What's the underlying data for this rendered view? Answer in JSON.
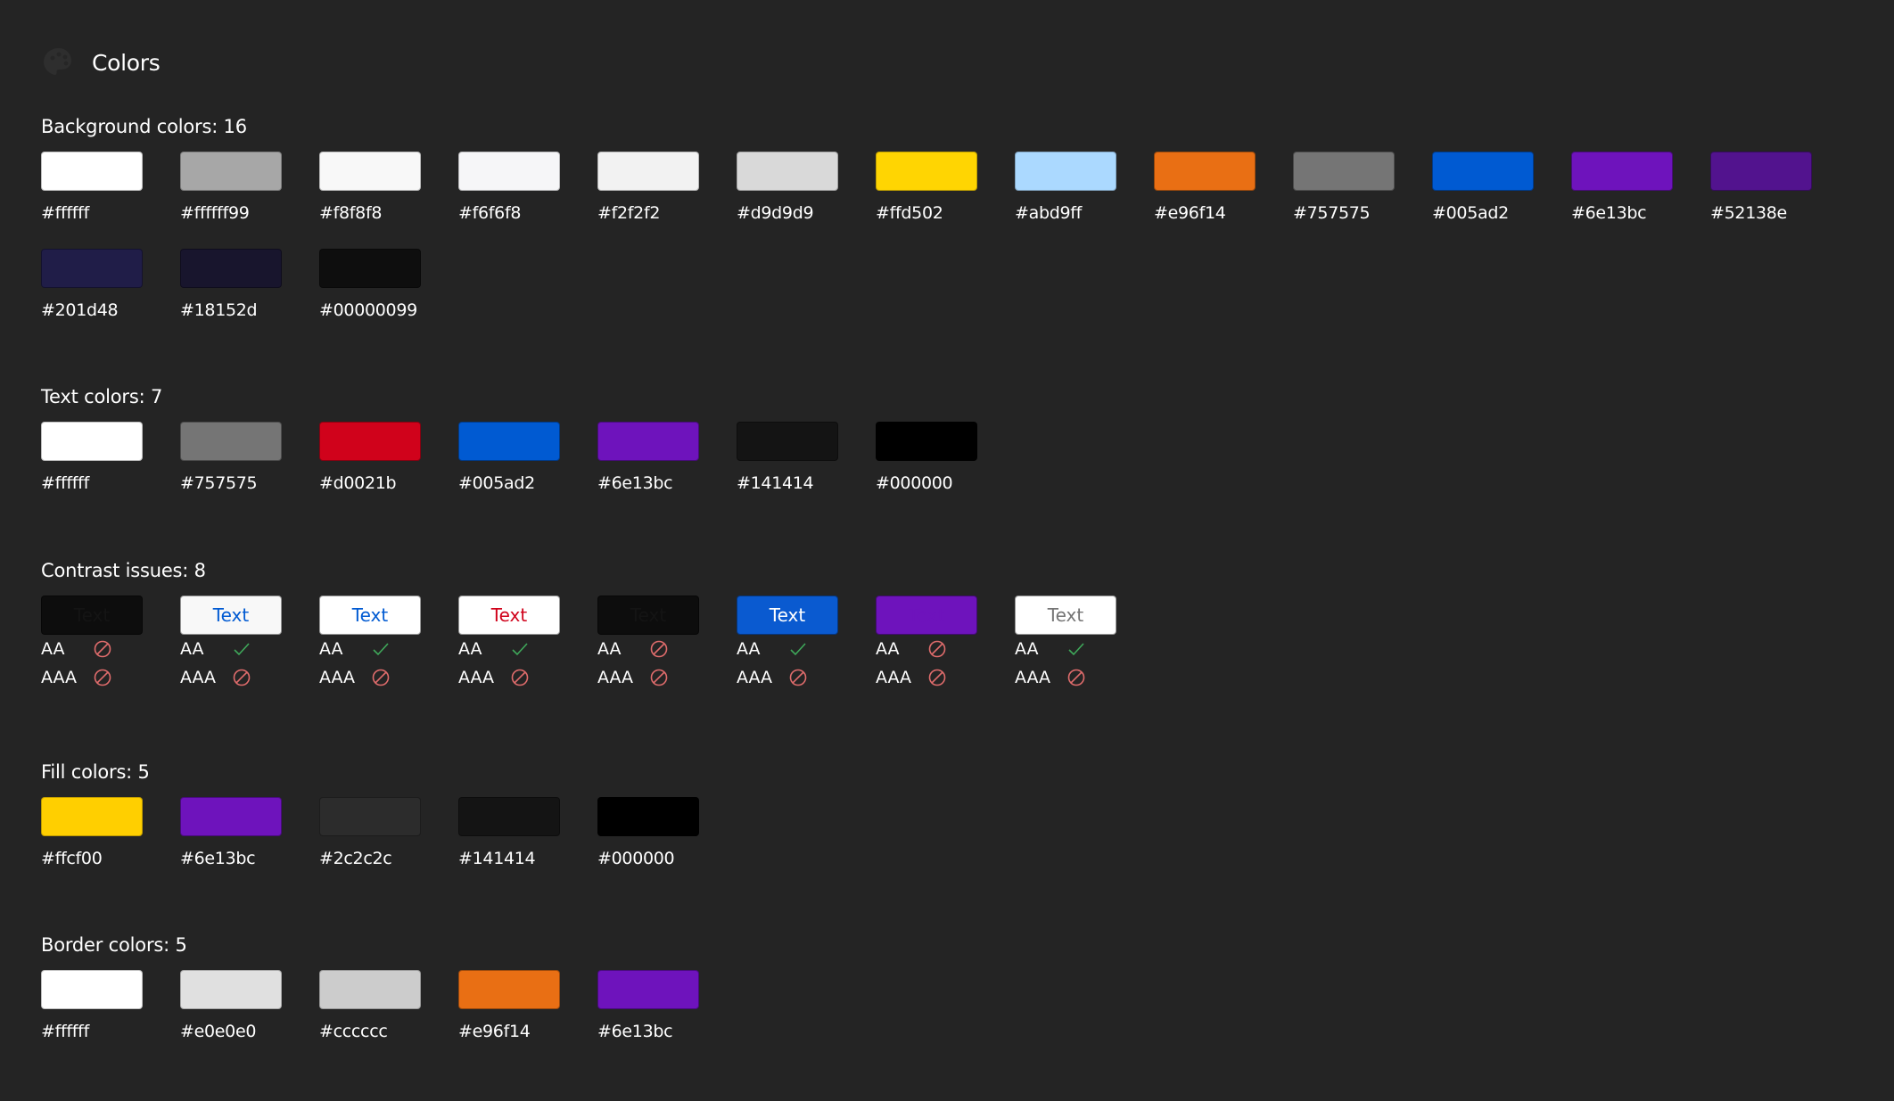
{
  "header": {
    "title": "Colors",
    "icon": "palette-icon"
  },
  "sections": {
    "background": {
      "title": "Background colors: 16",
      "colors": [
        "#ffffff",
        "#ffffff99",
        "#f8f8f8",
        "#f6f6f8",
        "#f2f2f2",
        "#d9d9d9",
        "#ffd502",
        "#abd9ff",
        "#e96f14",
        "#757575",
        "#005ad2",
        "#6e13bc",
        "#52138e",
        "#201d48",
        "#18152d",
        "#00000099"
      ]
    },
    "text": {
      "title": "Text colors: 7",
      "colors": [
        "#ffffff",
        "#757575",
        "#d0021b",
        "#005ad2",
        "#6e13bc",
        "#141414",
        "#000000"
      ]
    },
    "contrast": {
      "title": "Contrast issues: 8",
      "sample_text": "Text",
      "aa_label": "AA",
      "aaa_label": "AAA",
      "pass_color": "#3fa85a",
      "fail_color": "#e06c6c",
      "items": [
        {
          "bg": "#0d0d0d",
          "fg": "#141414",
          "aa": false,
          "aaa": false
        },
        {
          "bg": "#f8f8f8",
          "fg": "#005ad2",
          "aa": true,
          "aaa": false
        },
        {
          "bg": "#ffffff",
          "fg": "#005ad2",
          "aa": true,
          "aaa": false
        },
        {
          "bg": "#ffffff",
          "fg": "#d0021b",
          "aa": true,
          "aaa": false
        },
        {
          "bg": "#0d0d0d",
          "fg": "#141414",
          "aa": false,
          "aaa": false
        },
        {
          "bg": "#0a5ad0",
          "fg": "#ffffff",
          "aa": true,
          "aaa": false
        },
        {
          "bg": "#6e13bc",
          "fg": "#6e13bc",
          "aa": false,
          "aaa": false
        },
        {
          "bg": "#ffffff",
          "fg": "#757575",
          "aa": true,
          "aaa": false
        }
      ]
    },
    "fill": {
      "title": "Fill colors: 5",
      "colors": [
        "#ffcf00",
        "#6e13bc",
        "#2c2c2c",
        "#141414",
        "#000000"
      ]
    },
    "border": {
      "title": "Border colors: 5",
      "colors": [
        "#ffffff",
        "#e0e0e0",
        "#cccccc",
        "#e96f14",
        "#6e13bc"
      ]
    }
  }
}
